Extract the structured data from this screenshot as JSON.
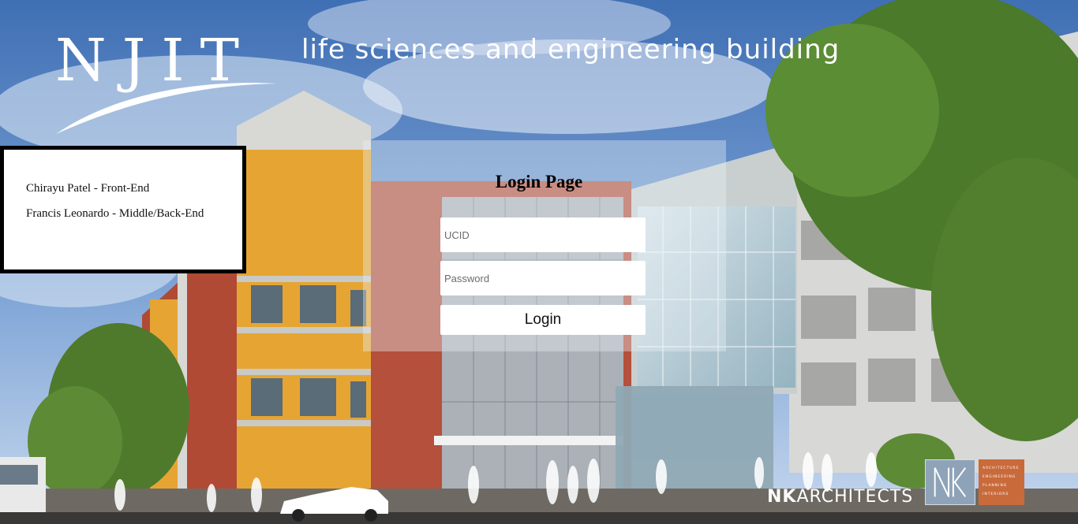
{
  "header": {
    "logo_text": "NJIT",
    "tagline": "life sciences and engineering building"
  },
  "credits": {
    "lines": [
      "Chirayu Patel - Front-End",
      "Francis Leonardo - Middle/Back-End"
    ]
  },
  "login": {
    "title": "Login Page",
    "ucid_placeholder": "UCID",
    "password_placeholder": "Password",
    "button_label": "Login"
  },
  "architect": {
    "name_bold": "NK",
    "name_rest": "ARCHITECTS",
    "services": [
      "ARCHITECTURE",
      "ENGINEERING",
      "PLANNING",
      "INTERIORS"
    ]
  },
  "colors": {
    "sky": "#5b86c4",
    "brick": "#b94a36",
    "yellow": "#e9a834",
    "glass": "#b9cfd9",
    "foliage": "#4f7a2c",
    "nk_orange": "#c96a3a"
  },
  "icons": {
    "nk_mark": "nk-monogram-icon",
    "swoosh": "swoosh-icon"
  }
}
